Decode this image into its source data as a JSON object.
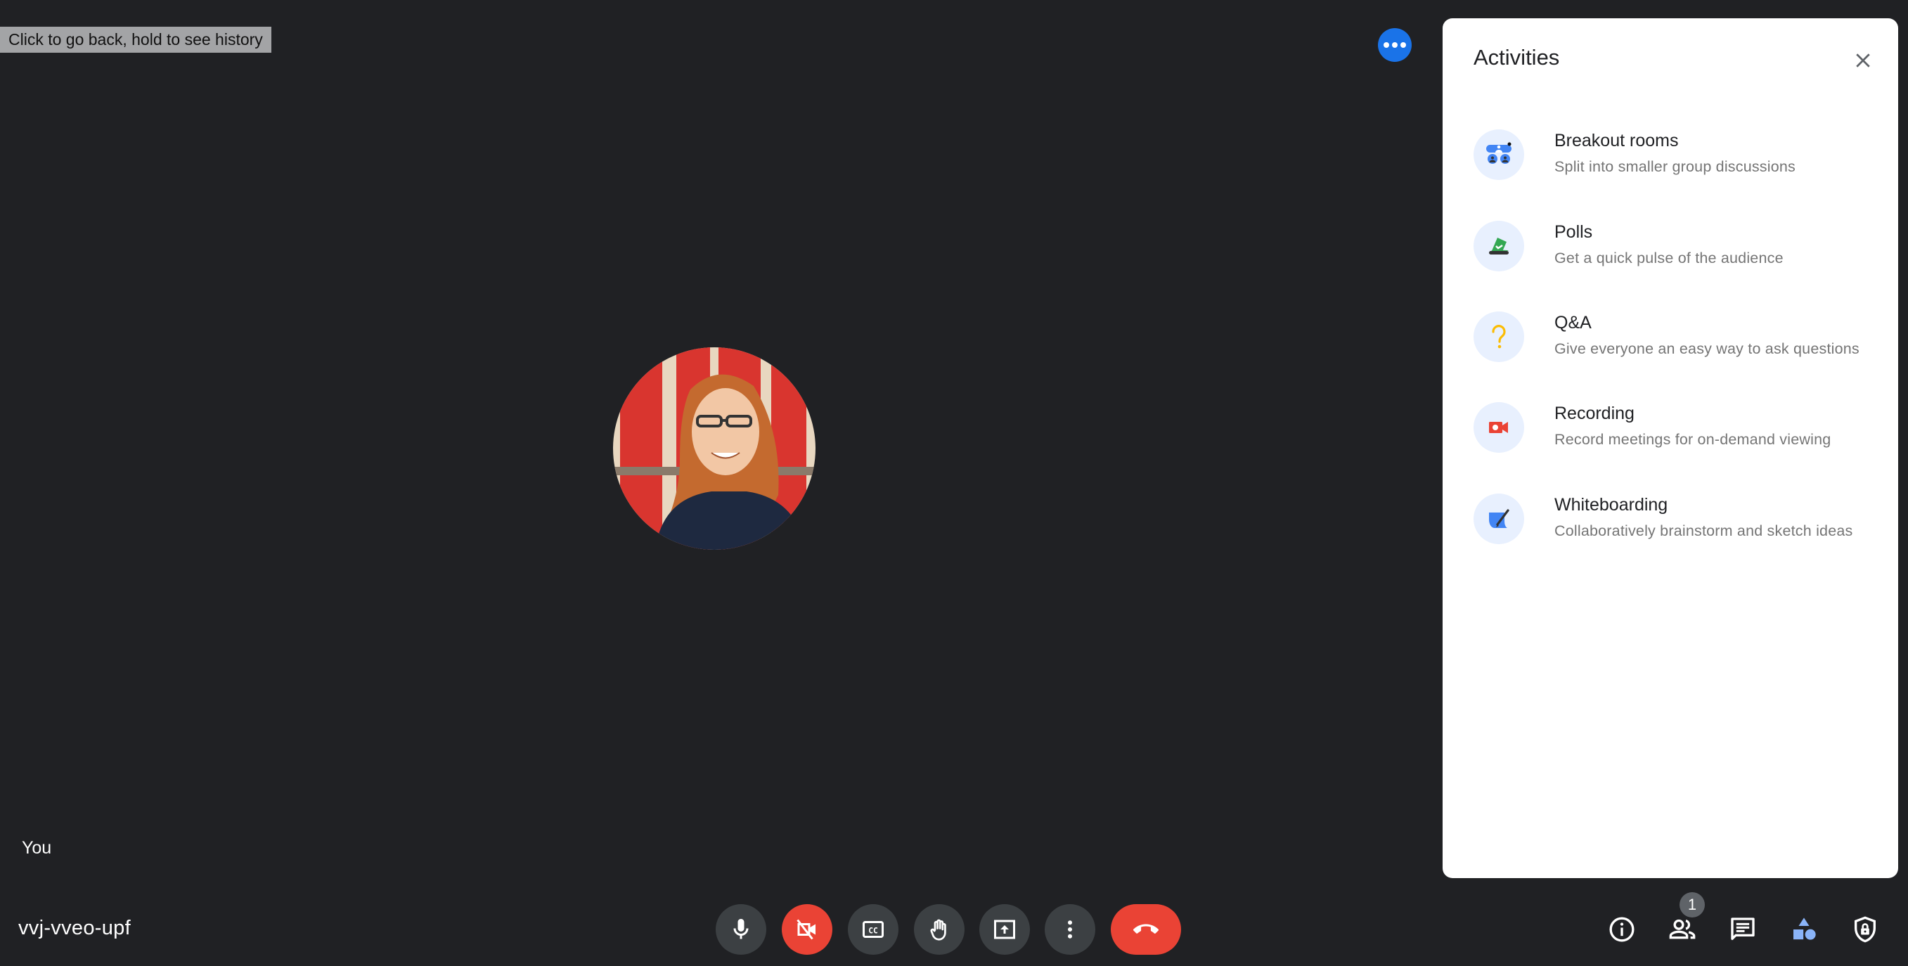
{
  "browser": {
    "back_tooltip": "Click to go back, hold to see history"
  },
  "stage": {
    "self_label": "You",
    "meeting_code": "vvj-vveo-upf"
  },
  "controls": [
    {
      "name": "microphone-button",
      "icon": "mic-icon",
      "label": "Turn off microphone",
      "state": "on"
    },
    {
      "name": "camera-button",
      "icon": "camera-off-icon",
      "label": "Turn on camera",
      "state": "off"
    },
    {
      "name": "captions-button",
      "icon": "closed-captions-icon",
      "label": "Turn on captions"
    },
    {
      "name": "raise-hand-button",
      "icon": "hand-icon",
      "label": "Raise hand"
    },
    {
      "name": "present-button",
      "icon": "present-screen-icon",
      "label": "Present now"
    },
    {
      "name": "more-options-button",
      "icon": "more-vert-icon",
      "label": "More options"
    },
    {
      "name": "leave-call-button",
      "icon": "call-end-icon",
      "label": "Leave call"
    }
  ],
  "side_buttons": {
    "info": "Meeting details",
    "people": "Show everyone",
    "people_count": "1",
    "chat": "Chat with everyone",
    "activities": "Activities",
    "host_controls": "Host controls"
  },
  "colors": {
    "background": "#202124",
    "danger": "#ea4335",
    "control_bg": "#3c4043",
    "accent_blue": "#1a73e8",
    "activities_active": "#8ab4f8"
  },
  "panel": {
    "title": "Activities",
    "close_label": "Close",
    "items": [
      {
        "title": "Breakout rooms",
        "subtitle": "Split into smaller group discussions",
        "icon": "breakout-rooms-icon"
      },
      {
        "title": "Polls",
        "subtitle": "Get a quick pulse of the audience",
        "icon": "polls-icon"
      },
      {
        "title": "Q&A",
        "subtitle": "Give everyone an easy way to ask questions",
        "icon": "qa-icon"
      },
      {
        "title": "Recording",
        "subtitle": "Record meetings for on-demand viewing",
        "icon": "recording-icon"
      },
      {
        "title": "Whiteboarding",
        "subtitle": "Collaboratively brainstorm and sketch ideas",
        "icon": "whiteboard-icon"
      }
    ]
  }
}
